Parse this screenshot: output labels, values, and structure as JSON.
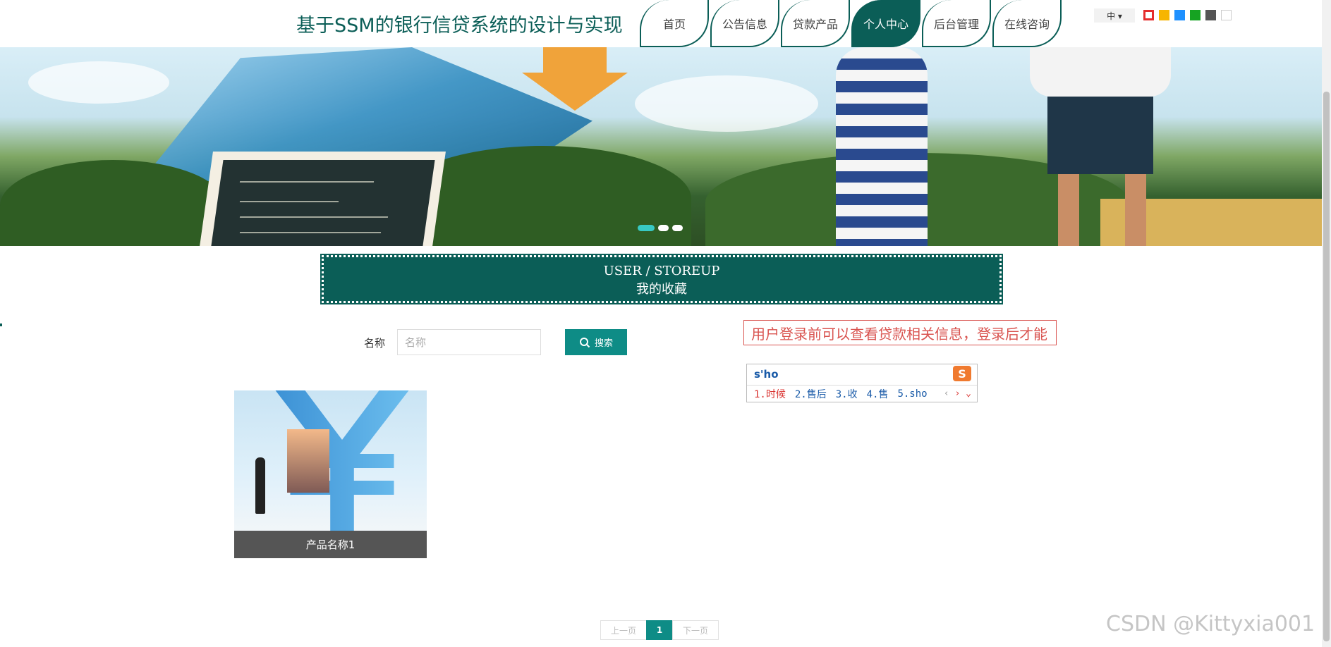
{
  "header": {
    "site_title": "基于SSM的银行信贷系统的设计与实现",
    "nav": [
      {
        "label": "首页"
      },
      {
        "label": "公告信息"
      },
      {
        "label": "贷款产品"
      },
      {
        "label": "个人中心",
        "active": true
      },
      {
        "label": "后台管理"
      },
      {
        "label": "在线咨询"
      }
    ],
    "language": "中 ▾",
    "theme_colors": [
      "#e52d2d",
      "#f7b500",
      "#1e90ff",
      "#16a322",
      "#555555",
      "#ffffff"
    ]
  },
  "banner": {
    "dots": 3,
    "active_dot": 0
  },
  "section": {
    "title_en": "USER / STOREUP",
    "title_cn": "我的收藏"
  },
  "search": {
    "label": "名称",
    "placeholder": "名称",
    "button_label": "搜索"
  },
  "notice": {
    "text": "用户登录前可以查看贷款相关信息，登录后才能"
  },
  "ime": {
    "input": "s'ho",
    "logo": "S",
    "candidates": [
      "1.时候",
      "2.售后",
      "3.收",
      "4.售",
      "5.sho"
    ],
    "prev": "‹",
    "next": "›",
    "expand": "⌄"
  },
  "products": [
    {
      "name": "产品名称1"
    }
  ],
  "pagination": {
    "prev": "上一页",
    "current": "1",
    "next": "下一页"
  },
  "watermark": "CSDN @Kittyxia001"
}
